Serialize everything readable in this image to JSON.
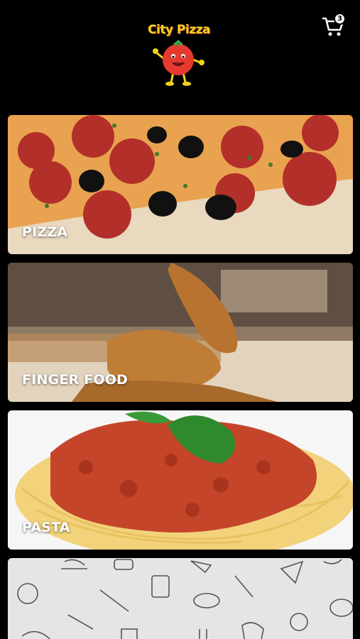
{
  "app": {
    "logo_text": "City Pizza",
    "cart_count": "3"
  },
  "categories": [
    {
      "label": "PIZZA"
    },
    {
      "label": "FINGER FOOD"
    },
    {
      "label": "PASTA"
    },
    {
      "label": ""
    }
  ],
  "colors": {
    "background": "#000000",
    "logo_yellow": "#f4d21a",
    "tomato_red": "#e53a2f",
    "label_text": "#ffffff"
  }
}
